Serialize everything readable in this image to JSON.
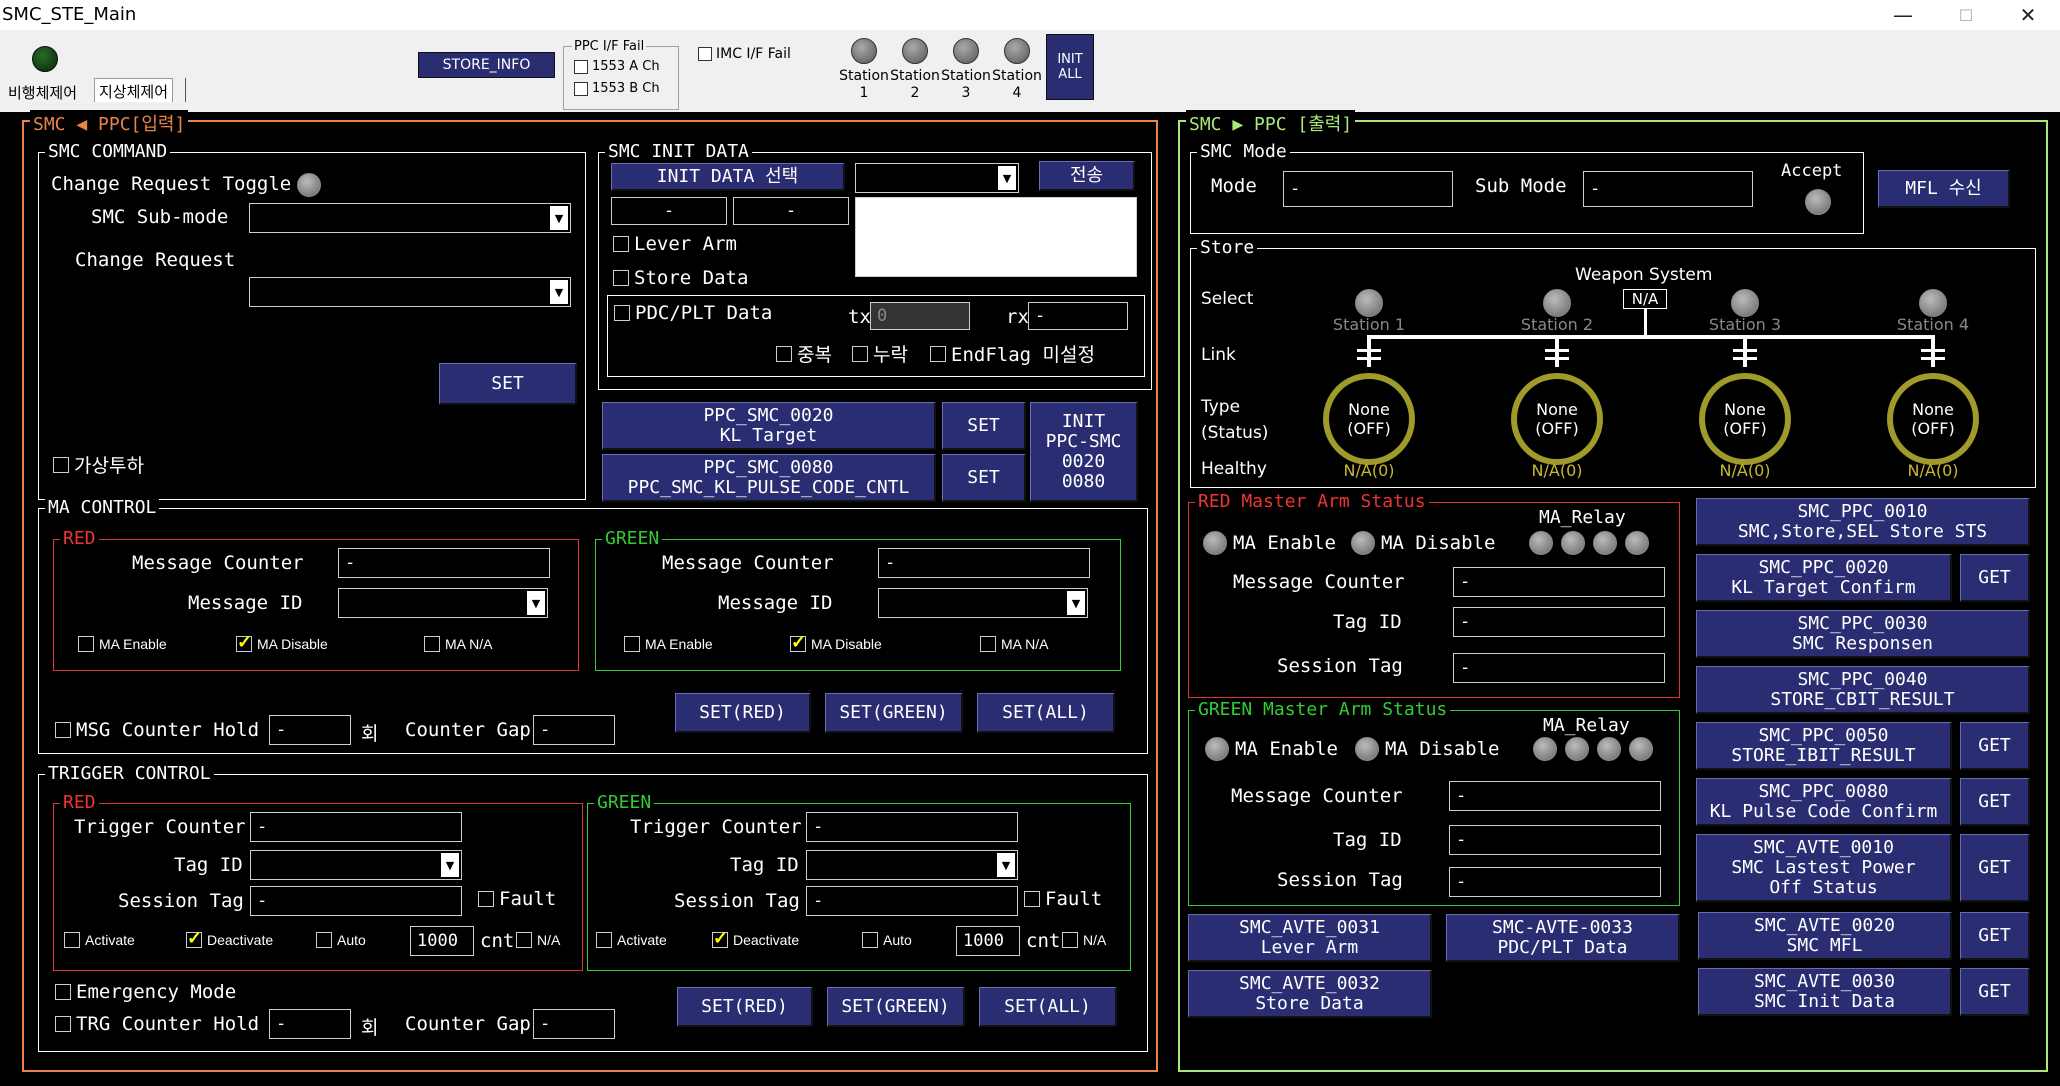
{
  "window": {
    "title": "SMC_STE_Main",
    "minimize": "—",
    "maximize": "☐",
    "close": "✕"
  },
  "toolbar": {
    "tabs": [
      "비행체제어",
      "지상체제어"
    ],
    "store_info": "STORE_INFO",
    "ppc_if_fail": {
      "label": "PPC I/F Fail",
      "a": "1553 A Ch",
      "b": "1553 B Ch"
    },
    "imc_if_fail": "IMC I/F Fail",
    "stations": [
      {
        "l1": "Station",
        "l2": "1"
      },
      {
        "l1": "Station",
        "l2": "2"
      },
      {
        "l1": "Station",
        "l2": "3"
      },
      {
        "l1": "Station",
        "l2": "4"
      }
    ],
    "init_all": {
      "l1": "INIT",
      "l2": "ALL"
    }
  },
  "left": {
    "title": "SMC ◀ PPC[입력]",
    "smc_command": {
      "title": "SMC COMMAND",
      "toggle": "Change Request Toggle",
      "submode": "SMC Sub-mode",
      "change_request": "Change Request",
      "set": "SET",
      "virtual": "가상투하"
    },
    "init_data": {
      "title": "SMC INIT DATA",
      "select": "INIT DATA 선택",
      "send": "전송",
      "f1": "-",
      "f2": "-",
      "lever_arm": "Lever Arm",
      "store_data": "Store Data",
      "pdc": "PDC/PLT Data",
      "tx": "tx",
      "tx_val": "0",
      "rx": "rx",
      "rx_val": "-",
      "dup": "중복",
      "miss": "누락",
      "endflag": "EndFlag 미설정"
    },
    "ppc_buttons": {
      "b1l1": "PPC_SMC_0020",
      "b1l2": "KL Target",
      "b2l1": "PPC_SMC_0080",
      "b2l2": "PPC_SMC_KL_PULSE_CODE_CNTL",
      "set": "SET",
      "init1": "INIT",
      "init2": "PPC-SMC",
      "init3": "0020",
      "init4": "0080"
    },
    "ma": {
      "title": "MA CONTROL",
      "red": "RED",
      "green": "GREEN",
      "msg_counter": "Message Counter",
      "msg_id": "Message ID",
      "counter_val": "-",
      "ma_enable": "MA Enable",
      "ma_disable": "MA Disable",
      "ma_na": "MA N/A",
      "hold": "MSG Counter Hold",
      "hold_val": "-",
      "times": "회",
      "gap": "Counter Gap",
      "gap_val": "-",
      "set_red": "SET(RED)",
      "set_green": "SET(GREEN)",
      "set_all": "SET(ALL)"
    },
    "trigger": {
      "title": "TRIGGER CONTROL",
      "red": "RED",
      "green": "GREEN",
      "trig_counter": "Trigger Counter",
      "tag_id": "Tag ID",
      "session_tag": "Session Tag",
      "val": "-",
      "fault": "Fault",
      "activate": "Activate",
      "deactivate": "Deactivate",
      "auto": "Auto",
      "cnt_val": "1000",
      "cnt": "cnt",
      "na": "N/A",
      "emergency": "Emergency Mode",
      "hold": "TRG Counter Hold",
      "hold_val": "-",
      "times": "회",
      "gap": "Counter Gap",
      "gap_val": "-",
      "set_red": "SET(RED)",
      "set_green": "SET(GREEN)",
      "set_all": "SET(ALL)"
    }
  },
  "right": {
    "title": "SMC ▶ PPC [출력]",
    "mode": {
      "title": "SMC Mode",
      "mode": "Mode",
      "mode_val": "-",
      "sub": "Sub Mode",
      "sub_val": "-",
      "accept": "Accept",
      "mfl": "MFL 수신"
    },
    "store": {
      "title": "Store",
      "weapon_system": "Weapon System",
      "ws_val": "N/A",
      "select": "Select",
      "link": "Link",
      "type": "Type",
      "status": "(Status)",
      "healthy": "Healthy",
      "stations": [
        {
          "name": "Station 1",
          "l1": "None",
          "l2": "(OFF)",
          "health": "N/A(0)"
        },
        {
          "name": "Station 2",
          "l1": "None",
          "l2": "(OFF)",
          "health": "N/A(0)"
        },
        {
          "name": "Station 3",
          "l1": "None",
          "l2": "(OFF)",
          "health": "N/A(0)"
        },
        {
          "name": "Station 4",
          "l1": "None",
          "l2": "(OFF)",
          "health": "N/A(0)"
        }
      ]
    },
    "red_ma": {
      "title": "RED Master Arm Status",
      "relay": "MA_Relay",
      "enable": "MA Enable",
      "disable": "MA Disable",
      "msg_counter": "Message Counter",
      "tag_id": "Tag ID",
      "session_tag": "Session Tag",
      "val": "-"
    },
    "green_ma": {
      "title": "GREEN Master Arm Status",
      "relay": "MA_Relay",
      "enable": "MA Enable",
      "disable": "MA Disable",
      "msg_counter": "Message Counter",
      "tag_id": "Tag ID",
      "session_tag": "Session Tag",
      "val": "-"
    },
    "buttons": [
      {
        "l1": "SMC_PPC_0010",
        "l2": "SMC,Store,SEL Store STS"
      },
      {
        "l1": "SMC_PPC_0020",
        "l2": "KL Target Confirm"
      },
      {
        "l1": "SMC_PPC_0030",
        "l2": "SMC Responsen"
      },
      {
        "l1": "SMC_PPC_0040",
        "l2": "STORE_CBIT_RESULT"
      },
      {
        "l1": "SMC_PPC_0050",
        "l2": "STORE_IBIT_RESULT"
      },
      {
        "l1": "SMC_PPC_0080",
        "l2": "KL Pulse Code Confirm"
      },
      {
        "l1": "SMC_AVTE_0010",
        "l2": "SMC Lastest Power",
        "l3": "Off Status"
      },
      {
        "l1": "SMC_AVTE_0020",
        "l2": "SMC MFL"
      },
      {
        "l1": "SMC_AVTE_0030",
        "l2": "SMC Init Data"
      }
    ],
    "avte": [
      {
        "l1": "SMC_AVTE_0031",
        "l2": "Lever Arm"
      },
      {
        "l1": "SMC-AVTE-0033",
        "l2": "PDC/PLT Data"
      },
      {
        "l1": "SMC_AVTE_0032",
        "l2": "Store Data"
      }
    ],
    "get": "GET"
  }
}
